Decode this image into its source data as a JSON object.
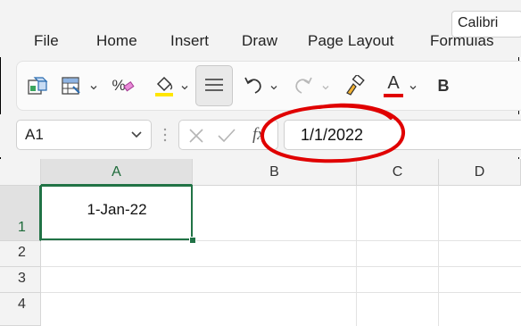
{
  "menu": {
    "items": [
      {
        "id": "file",
        "label": "File"
      },
      {
        "id": "home",
        "label": "Home"
      },
      {
        "id": "insert",
        "label": "Insert"
      },
      {
        "id": "draw",
        "label": "Draw"
      },
      {
        "id": "page-layout",
        "label": "Page Layout"
      },
      {
        "id": "formulas",
        "label": "Formulas"
      }
    ]
  },
  "ribbon": {
    "bold_label": "B",
    "font_color_label": "A",
    "font_name": "Calibri",
    "percent_label": "%",
    "colors": {
      "fill": "#ffe600",
      "font": "#e00000",
      "brand": "#217346"
    }
  },
  "formula_bar": {
    "name_box": "A1",
    "fx_label": "fx",
    "formula": "1/1/2022"
  },
  "sheet": {
    "columns": [
      "A",
      "B",
      "C",
      "D"
    ],
    "rows": [
      "1",
      "2",
      "3",
      "4"
    ],
    "active_cell_value": "1-Jan-22"
  },
  "annotation": {
    "circle_color": "#e00000"
  }
}
